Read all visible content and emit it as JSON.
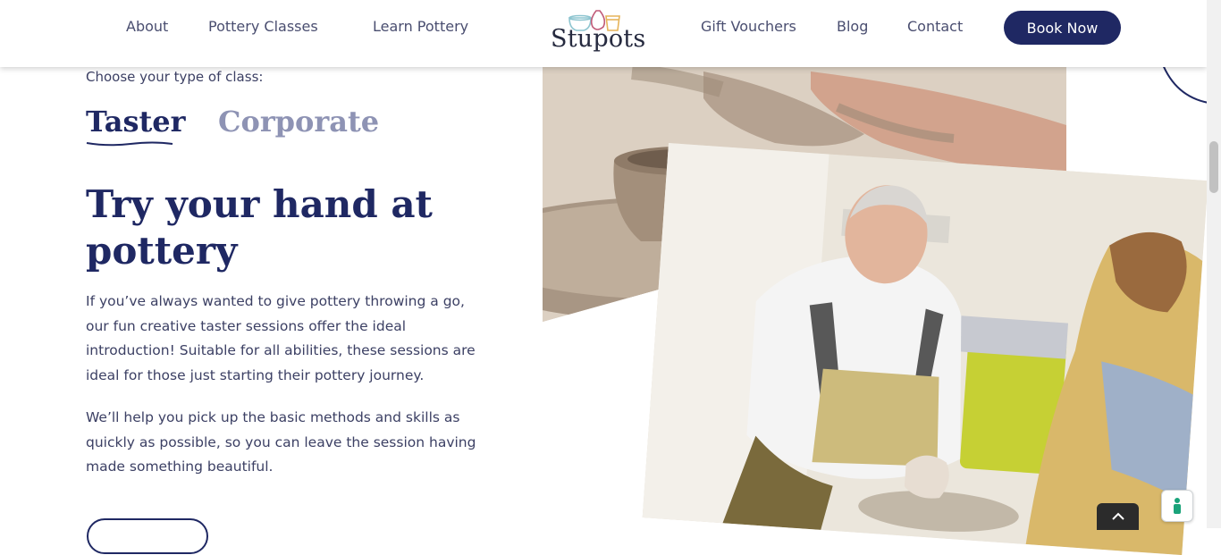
{
  "header": {
    "nav_left": [
      "About",
      "Pottery Classes",
      "Learn Pottery"
    ],
    "logo_text": "Stupots",
    "nav_right": [
      "Gift Vouchers",
      "Blog",
      "Contact"
    ],
    "cta_label": "Book Now"
  },
  "section": {
    "choose_label": "Choose your type of class:",
    "tabs": [
      {
        "label": "Taster",
        "active": true
      },
      {
        "label": "Corporate",
        "active": false
      }
    ],
    "heading": "Try your hand at pottery",
    "paragraphs": [
      "If you’ve always wanted to give pottery throwing a go, our fun creative taster sessions offer the ideal introduction! Suitable for all abilities, these sessions are ideal for those just starting their pottery journey.",
      "We’ll help you pick up the basic methods and skills as quickly as possible, so you can leave the session having made something beautiful."
    ]
  },
  "colors": {
    "brand_navy": "#1f2863",
    "inactive_tab": "#8e93b4",
    "body_text": "#3c4064"
  },
  "icons": [
    "chevron-up-icon",
    "accessibility-icon"
  ]
}
